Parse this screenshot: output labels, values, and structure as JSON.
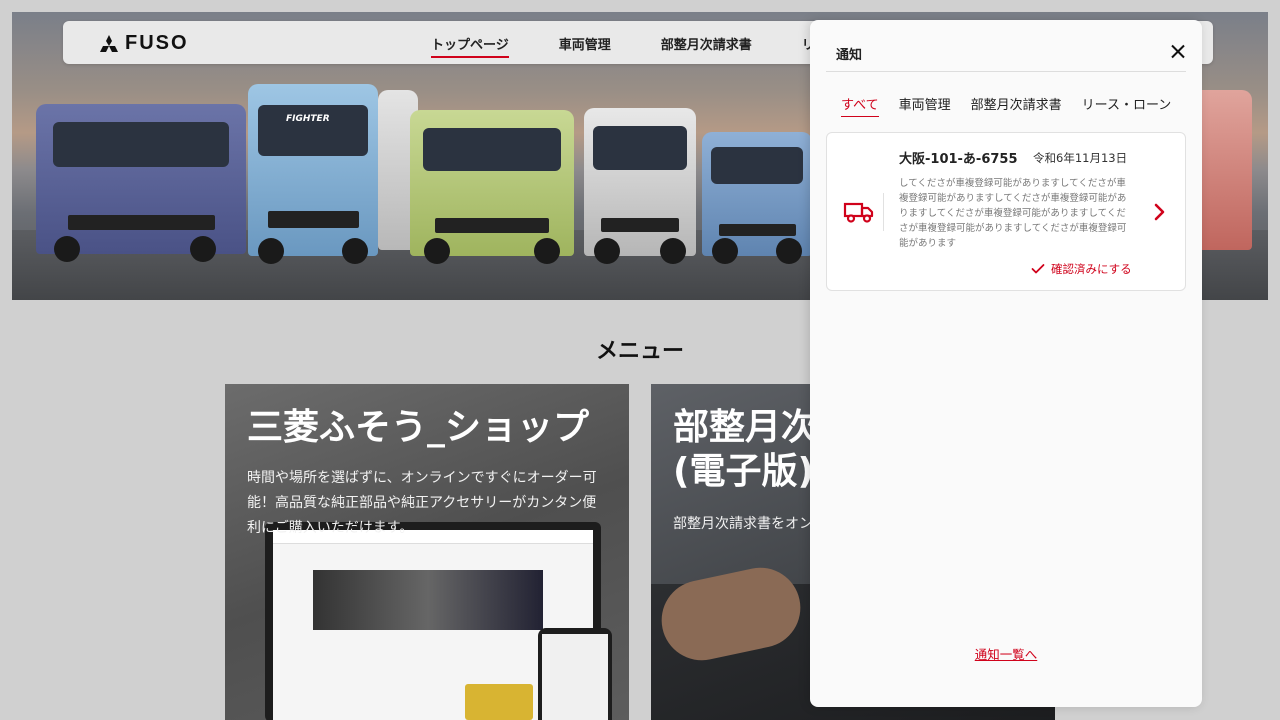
{
  "header": {
    "logo_text": "FUSO",
    "nav": [
      "トップページ",
      "車両管理",
      "部整月次請求書",
      "リー"
    ]
  },
  "hero": {
    "vehicle_badges": [
      "FIGHTER"
    ]
  },
  "menu": {
    "title": "メニュー",
    "cards": [
      {
        "title": "三菱ふそう_ショップ",
        "description": "時間や場所を選ばずに、オンラインですぐにオーダー可能！高品質な純正部品や純正アクセサリーがカンタン便利にご購入いただけます。"
      },
      {
        "title_line1": "部整月次",
        "title_line2": "(電子版)",
        "description": "部整月次請求書をオン ます。"
      }
    ]
  },
  "notifications": {
    "title": "通知",
    "tabs": [
      "すべて",
      "車両管理",
      "部整月次請求書",
      "リース・ローン"
    ],
    "active_tab": "すべて",
    "items": [
      {
        "icon": "truck-icon",
        "plate": "大阪-101-あ-6755",
        "date": "令和6年11月13日",
        "body": "してくださが車複登録可能がありますしてくださが車複登録可能がありますしてくださが車複登録可能がありますしてくださが車複登録可能がありますしてくださが車複登録可能がありますしてくださが車複登録可能があります",
        "action": "確認済みにする"
      }
    ],
    "footer_link": "通知一覧へ"
  },
  "colors": {
    "accent": "#d0021b",
    "panel_bg": "#fafafa",
    "nav_bg": "#e9e9e9"
  }
}
